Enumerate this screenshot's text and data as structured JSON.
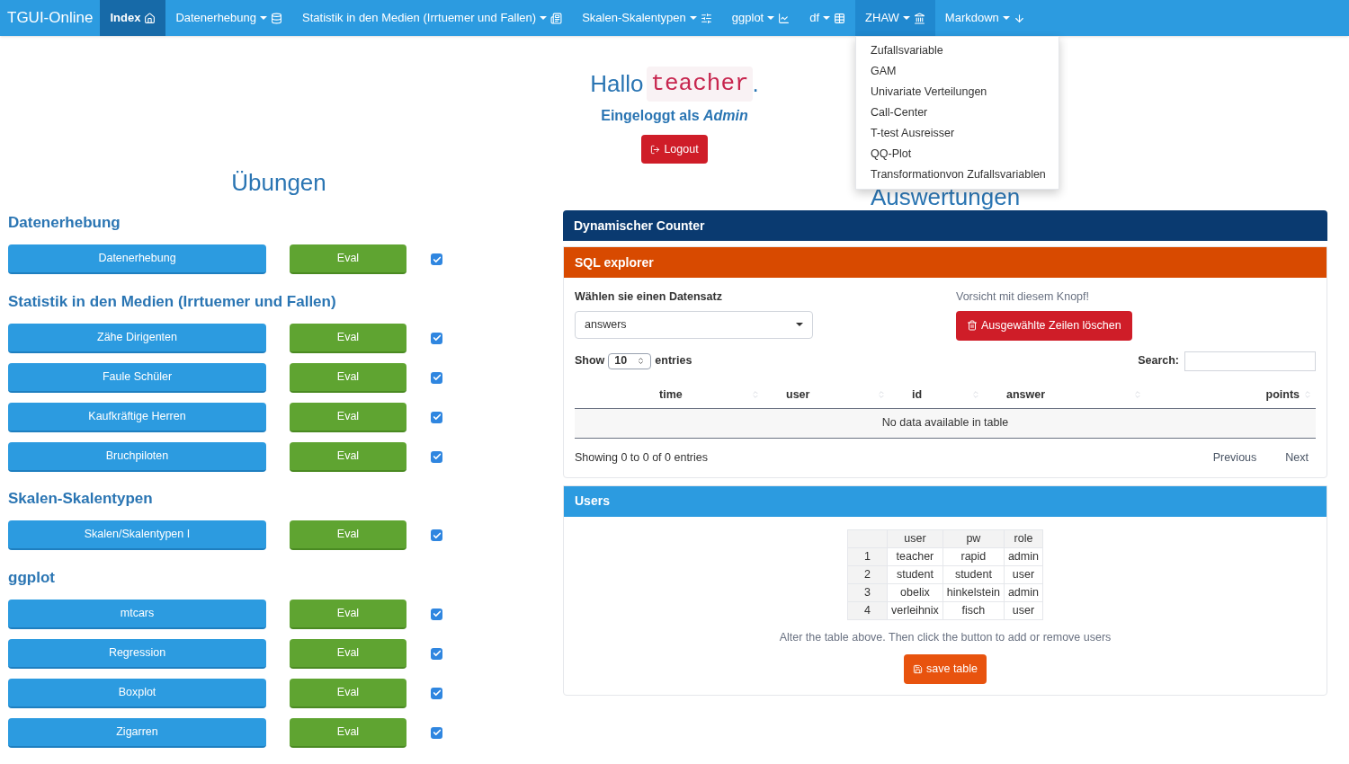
{
  "navbar": {
    "brand": "TGUI-Online",
    "items": [
      {
        "label": "Index",
        "dropdown": false,
        "selected": true,
        "open": false
      },
      {
        "label": "Datenerhebung",
        "dropdown": true,
        "selected": false,
        "open": false
      },
      {
        "label": "Statistik in den Medien (Irrtuemer und Fallen)",
        "dropdown": true,
        "selected": false,
        "open": false
      },
      {
        "label": "Skalen-Skalentypen",
        "dropdown": true,
        "selected": false,
        "open": false
      },
      {
        "label": "ggplot",
        "dropdown": true,
        "selected": false,
        "open": false
      },
      {
        "label": "df",
        "dropdown": true,
        "selected": false,
        "open": false
      },
      {
        "label": "ZHAW",
        "dropdown": true,
        "selected": false,
        "open": true
      },
      {
        "label": "Markdown",
        "dropdown": true,
        "selected": false,
        "open": false
      }
    ],
    "menu_items": [
      "Zufallsvariable",
      "GAM",
      "Univariate Verteilungen",
      "Call-Center",
      "T-test Ausreisser",
      "QQ-Plot",
      "Transformationvon Zufallsvariablen"
    ]
  },
  "greeting": {
    "hello": "Hallo",
    "user": "teacher",
    "period": ".",
    "login_line": "Eingeloggt als *Admin*",
    "logout_button": "Logout"
  },
  "exercises": {
    "title": "Übungen",
    "sections": [
      {
        "title": "Datenerhebung",
        "items": [
          {
            "label": "Datenerhebung",
            "eval": "Eval",
            "checked": true
          }
        ]
      },
      {
        "title": "Statistik in den Medien (Irrtuemer und Fallen)",
        "items": [
          {
            "label": "Zähe Dirigenten",
            "eval": "Eval",
            "checked": true
          },
          {
            "label": "Faule Schüler",
            "eval": "Eval",
            "checked": true
          },
          {
            "label": "Kaufkräftige Herren",
            "eval": "Eval",
            "checked": true
          },
          {
            "label": "Bruchpiloten",
            "eval": "Eval",
            "checked": true
          }
        ]
      },
      {
        "title": "Skalen-Skalentypen",
        "items": [
          {
            "label": "Skalen/Skalentypen I",
            "eval": "Eval",
            "checked": true
          }
        ]
      },
      {
        "title": "ggplot",
        "items": [
          {
            "label": "mtcars",
            "eval": "Eval",
            "checked": true
          },
          {
            "label": "Regression",
            "eval": "Eval",
            "checked": true
          },
          {
            "label": "Boxplot",
            "eval": "Eval",
            "checked": true
          },
          {
            "label": "Zigarren",
            "eval": "Eval",
            "checked": true
          }
        ]
      }
    ]
  },
  "evaluations": {
    "title": "Auswertungen",
    "counter_panel": {
      "title": "Dynamischer Counter"
    },
    "sql_panel": {
      "title": "SQL explorer",
      "dataset_label": "Wählen sie einen Datensatz",
      "dataset_value": "answers",
      "warning": "Vorsicht mit diesem Knopf!",
      "delete_button": "Ausgewählte Zeilen löschen",
      "show_label": "Show",
      "show_value": "10",
      "entries_label": "entries",
      "search_label": "Search:",
      "columns": [
        "time",
        "user",
        "id",
        "answer",
        "points"
      ],
      "empty_message": "No data available in table",
      "info": "Showing 0 to 0 of 0 entries",
      "previous": "Previous",
      "next": "Next"
    },
    "users_panel": {
      "title": "Users",
      "columns": [
        "user",
        "pw",
        "role"
      ],
      "rows": [
        {
          "index": "1",
          "cells": [
            "teacher",
            "rapid",
            "admin"
          ]
        },
        {
          "index": "2",
          "cells": [
            "student",
            "student",
            "user"
          ]
        },
        {
          "index": "3",
          "cells": [
            "obelix",
            "hinkelstein",
            "admin"
          ]
        },
        {
          "index": "4",
          "cells": [
            "verleihnix",
            "fisch",
            "user"
          ]
        }
      ],
      "hint": "Alter the table above. Then click the button to add or remove users",
      "save_button": "save table"
    }
  }
}
